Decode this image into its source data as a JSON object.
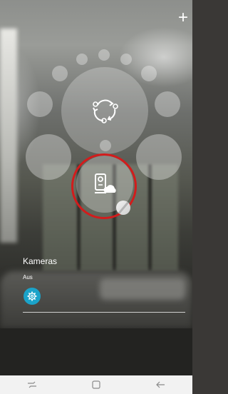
{
  "header": {
    "add_icon": "plus-icon",
    "add_label": "+"
  },
  "hub": {
    "center_icon": "sync-cycle-icon",
    "selected_device_icon": "camera-cloud-icon",
    "state_badge_icon": "disabled-indicator-icon"
  },
  "section": {
    "title": "Kameras",
    "status": "Aus",
    "settings_icon": "gear-icon"
  },
  "navbar": {
    "recent_icon": "recent-apps-icon",
    "home_icon": "home-square-icon",
    "back_icon": "back-arrow-icon"
  },
  "colors": {
    "highlight_ring": "#d21c1c",
    "settings_accent": "#1ba3c9",
    "navbar_bg": "#f2f2f2"
  }
}
